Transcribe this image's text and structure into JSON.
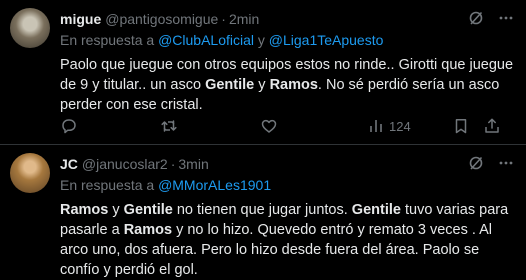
{
  "tweets": [
    {
      "name": "migue",
      "handle": "@pantigosomigue",
      "sep": "·",
      "time": "2min",
      "reply_prefix": "En respuesta a",
      "reply_to": [
        "@ClubALoficial",
        "@Liga1TeApuesto"
      ],
      "reply_joiner": "y",
      "text_parts": [
        {
          "t": "Paolo que juegue con otros equipos estos no rinde.. Girotti que juegue de 9 y titular.. un asco ",
          "b": false
        },
        {
          "t": "Gentile",
          "b": true
        },
        {
          "t": " y ",
          "b": false
        },
        {
          "t": "Ramos",
          "b": true
        },
        {
          "t": ". No sé perdió sería un asco perder con ese cristal.",
          "b": false
        }
      ],
      "views": "124",
      "icons": [
        "grok-icon",
        "more-icon",
        "reply-icon",
        "retweet-icon",
        "like-icon",
        "views-icon",
        "bookmark-icon",
        "share-icon"
      ]
    },
    {
      "name": "JC",
      "handle": "@janucoslar2",
      "sep": "·",
      "time": "3min",
      "reply_prefix": "En respuesta a",
      "reply_to": [
        "@MMorALes1901"
      ],
      "text_parts": [
        {
          "t": "Ramos",
          "b": true
        },
        {
          "t": " y ",
          "b": false
        },
        {
          "t": "Gentile",
          "b": true
        },
        {
          "t": " no tienen que jugar juntos. ",
          "b": false
        },
        {
          "t": "Gentile",
          "b": true
        },
        {
          "t": " tuvo varias para pasarle a ",
          "b": false
        },
        {
          "t": "Ramos",
          "b": true
        },
        {
          "t": " y no lo hizo. Quevedo entró y remato 3 veces . Al arco uno, dos afuera. Pero lo hizo desde fuera del área. Paolo se confío y perdió el gol.",
          "b": false
        }
      ],
      "icons": [
        "grok-icon",
        "more-icon"
      ]
    }
  ],
  "colors": {
    "background": "#000000",
    "text": "#e7e9ea",
    "muted": "#71767b",
    "link": "#1d9bf0",
    "divider": "#2f3336"
  }
}
